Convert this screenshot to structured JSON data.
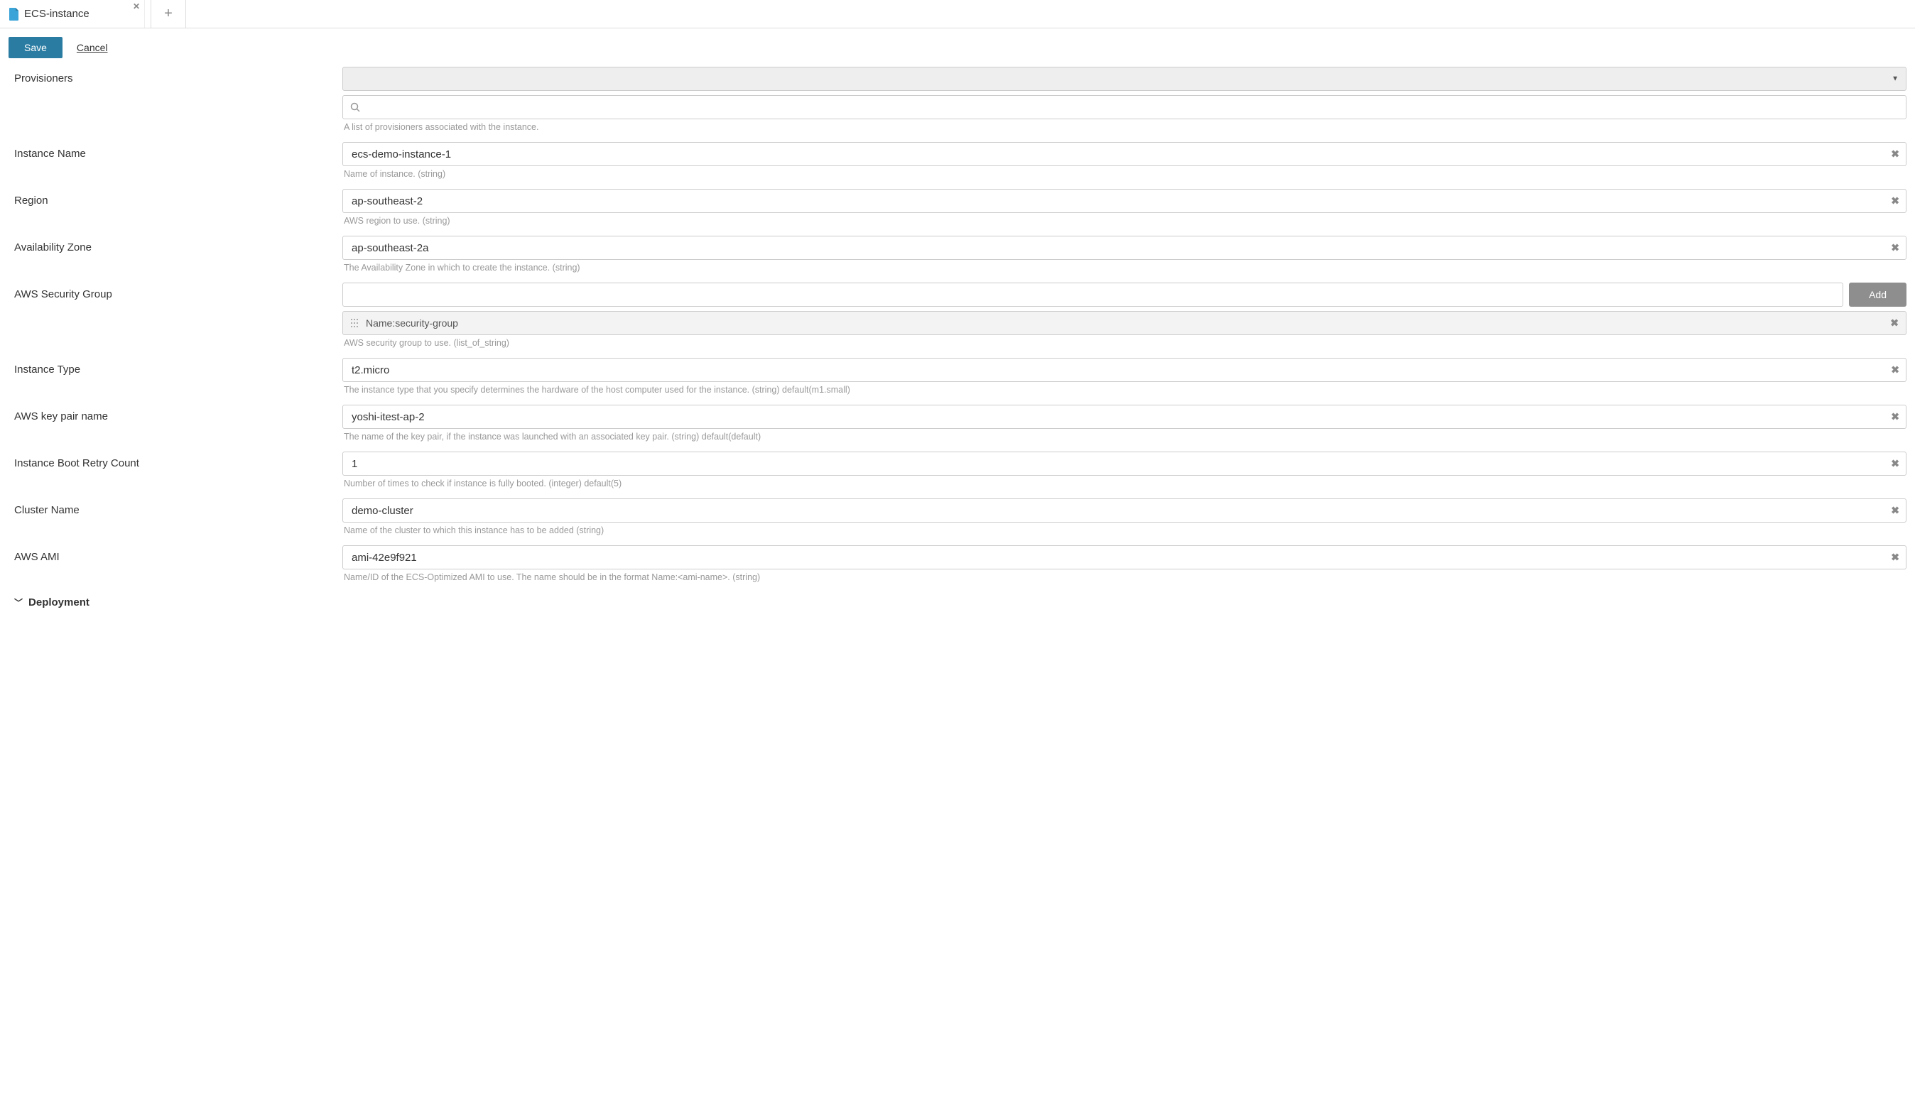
{
  "tabs": {
    "active": {
      "title": "ECS-instance"
    }
  },
  "toolbar": {
    "save_label": "Save",
    "cancel_label": "Cancel"
  },
  "fields": {
    "provisioners": {
      "label": "Provisioners",
      "help": "A list of provisioners associated with the instance."
    },
    "instance_name": {
      "label": "Instance Name",
      "value": "ecs-demo-instance-1",
      "help": "Name of instance. (string)"
    },
    "region": {
      "label": "Region",
      "value": "ap-southeast-2",
      "help": "AWS region to use. (string)"
    },
    "az": {
      "label": "Availability Zone",
      "value": "ap-southeast-2a",
      "help": "The Availability Zone in which to create the instance. (string)"
    },
    "sg": {
      "label": "AWS Security Group",
      "add_label": "Add",
      "items": [
        "Name:security-group"
      ],
      "help": "AWS security group to use. (list_of_string)"
    },
    "instance_type": {
      "label": "Instance Type",
      "value": "t2.micro",
      "help": "The instance type that you specify determines the hardware of the host computer used for the instance. (string) default(m1.small)"
    },
    "key_pair": {
      "label": "AWS key pair name",
      "value": "yoshi-itest-ap-2",
      "help": "The name of the key pair, if the instance was launched with an associated key pair. (string) default(default)"
    },
    "retry": {
      "label": "Instance Boot Retry Count",
      "value": "1",
      "help": "Number of times to check if instance is fully booted. (integer) default(5)"
    },
    "cluster": {
      "label": "Cluster Name",
      "value": "demo-cluster",
      "help": "Name of the cluster to which this instance has to be added (string)"
    },
    "ami": {
      "label": "AWS AMI",
      "value": "ami-42e9f921",
      "help": "Name/ID of the ECS-Optimized AMI to use. The name should be in the format Name:<ami-name>. (string)"
    }
  },
  "section": {
    "deployment_label": "Deployment"
  }
}
